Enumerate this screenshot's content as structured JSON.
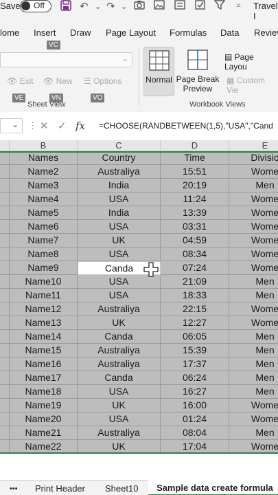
{
  "titlebar": {
    "save_label": "Save",
    "toggle_label": "Off",
    "doc_title": "Travel I"
  },
  "menu": {
    "tabs": [
      "Home",
      "Insert",
      "Draw",
      "Page Layout",
      "Formulas",
      "Data",
      "Review"
    ],
    "visible_tabs": [
      "lome",
      "Insert",
      "Draw",
      "Page Layout",
      "Formulas",
      "Data",
      "Reviev"
    ]
  },
  "keytips": {
    "vc": "VC",
    "ve": "VE",
    "vn": "VN",
    "vo": "VO"
  },
  "ribbon": {
    "sheet_view": {
      "exit": "Exit",
      "new": "New",
      "options": "Options",
      "label": "Sheet View"
    },
    "workbook_views": {
      "normal": "Normal",
      "page_break": "Page Break",
      "page_break_2": "Preview",
      "page_layout": "Page Layou",
      "custom_views": "Custom Vie",
      "label": "Workbook Views"
    }
  },
  "formula": {
    "fx": "fx",
    "text": "=CHOOSE(RANDBETWEEN(1,5),\"USA\",\"Cand"
  },
  "columns": [
    "B",
    "C",
    "D",
    "E"
  ],
  "header_row": {
    "b": "Names",
    "c": "Country",
    "d": "Time",
    "e": "Divisio"
  },
  "rows": [
    {
      "b": "Name2",
      "c": "Australiya",
      "d": "15:51",
      "e": "Wome"
    },
    {
      "b": "Name3",
      "c": "India",
      "d": "20:19",
      "e": "Men"
    },
    {
      "b": "Name4",
      "c": "USA",
      "d": "11:24",
      "e": "Wome"
    },
    {
      "b": "Name5",
      "c": "India",
      "d": "13:39",
      "e": "Wome"
    },
    {
      "b": "Name6",
      "c": "USA",
      "d": "03:31",
      "e": "Wome"
    },
    {
      "b": "Name7",
      "c": "UK",
      "d": "04:59",
      "e": "Wome"
    },
    {
      "b": "Name8",
      "c": "USA",
      "d": "08:34",
      "e": "Wome"
    },
    {
      "b": "Name9",
      "c": "Canda",
      "d": "07:24",
      "e": "Wome"
    },
    {
      "b": "Name10",
      "c": "USA",
      "d": "21:09",
      "e": "Men"
    },
    {
      "b": "Name11",
      "c": "USA",
      "d": "18:33",
      "e": "Men"
    },
    {
      "b": "Name12",
      "c": "Australiya",
      "d": "22:15",
      "e": "Wome"
    },
    {
      "b": "Name13",
      "c": "UK",
      "d": "12:27",
      "e": "Wome"
    },
    {
      "b": "Name14",
      "c": "Canda",
      "d": "06:05",
      "e": "Men"
    },
    {
      "b": "Name15",
      "c": "Australiya",
      "d": "15:39",
      "e": "Men"
    },
    {
      "b": "Name16",
      "c": "Australiya",
      "d": "17:37",
      "e": "Men"
    },
    {
      "b": "Name17",
      "c": "Canda",
      "d": "06:24",
      "e": "Men"
    },
    {
      "b": "Name18",
      "c": "USA",
      "d": "16:27",
      "e": "Men"
    },
    {
      "b": "Name19",
      "c": "UK",
      "d": "16:00",
      "e": "Wome"
    },
    {
      "b": "Name20",
      "c": "USA",
      "d": "01:24",
      "e": "Wome"
    },
    {
      "b": "Name21",
      "c": "Australiya",
      "d": "08:04",
      "e": "Men"
    },
    {
      "b": "Name22",
      "c": "UK",
      "d": "17:04",
      "e": "Wome"
    }
  ],
  "sheet_tabs": {
    "more": "•••",
    "tab1": "Print Header",
    "tab2": "Sheet10",
    "active": "Sample data create formula"
  },
  "colors": {
    "accent": "#2f7d4a",
    "selection_fill": "#bdbdbd",
    "toolbar": "#f3f3f3"
  }
}
